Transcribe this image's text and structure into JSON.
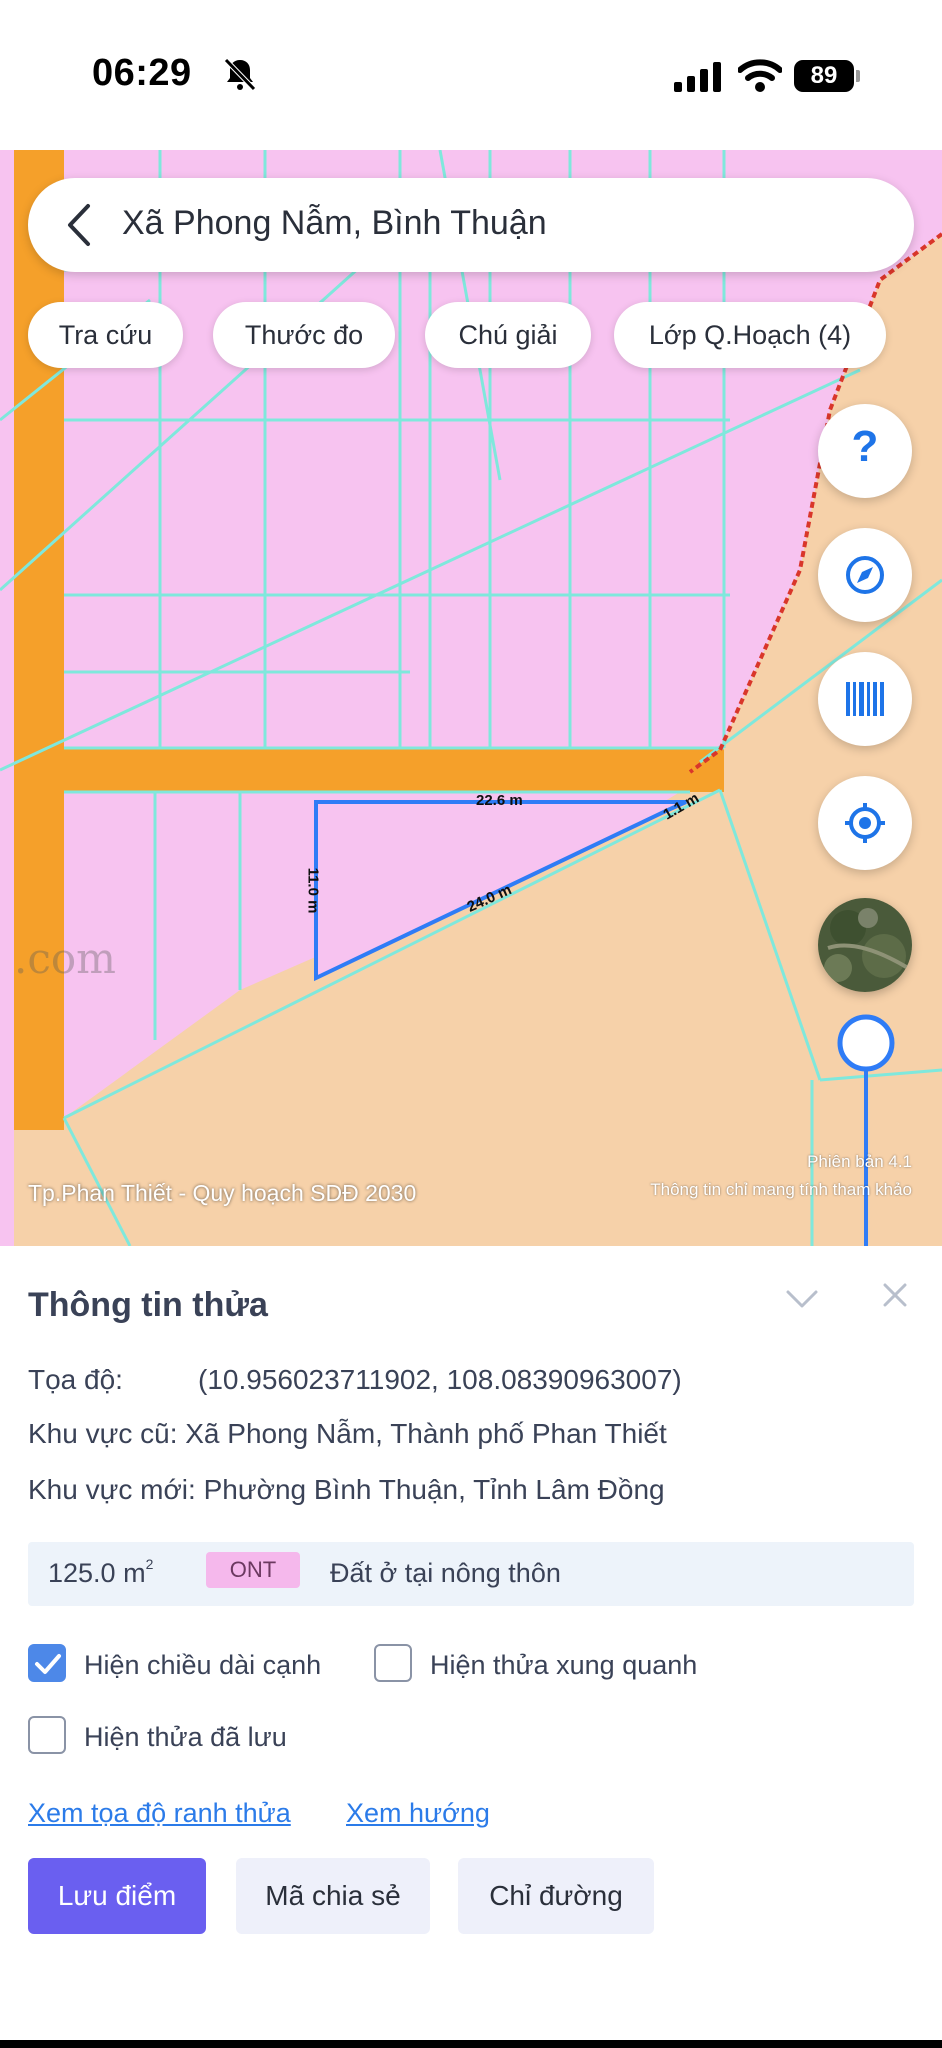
{
  "status_bar": {
    "time": "06:29",
    "battery": "89"
  },
  "search": {
    "title": "Xã Phong Nẫm, Bình Thuận"
  },
  "chips": [
    {
      "label": "Tra cứu"
    },
    {
      "label": "Thước đo"
    },
    {
      "label": "Chú giải"
    },
    {
      "label": "Lớp Q.Hoạch (4)"
    }
  ],
  "map": {
    "measurements": {
      "top": "22.6 m",
      "left": "11.0 m",
      "diagonal": "24.0 m",
      "corner": "1.1 m"
    },
    "watermark": ".com",
    "caption_left": "Tp.Phan Thiết - Quy hoạch SDĐ 2030",
    "caption_version": "Phiên bản 4.1",
    "caption_note": "Thông tin chỉ mang tính tham khảo",
    "colors": {
      "residential": "#f7c3f0",
      "agricultural": "#f6d1a9",
      "road": "#f5a02a",
      "parcel_lines": "#7fe8dc",
      "selection": "#2f7cf6"
    }
  },
  "panel": {
    "title": "Thông tin thửa",
    "coord_label": "Tọa độ:",
    "coord_value": "(10.956023711902, 108.08390963007)",
    "old_area": "Khu vực cũ: Xã Phong Nẫm, Thành phố Phan Thiết",
    "new_area": "Khu vực mới: Phường Bình Thuận, Tỉnh Lâm Đồng",
    "land": {
      "area": "125.0 m",
      "area_unit_sup": "2",
      "code": "ONT",
      "type": "Đất ở tại nông thôn"
    },
    "options": {
      "show_edge_length": {
        "label": "Hiện chiều dài cạnh",
        "checked": true
      },
      "show_neighbors": {
        "label": "Hiện thửa xung quanh",
        "checked": false
      },
      "show_saved": {
        "label": "Hiện thửa đã lưu",
        "checked": false
      }
    },
    "links": {
      "boundary_coords": "Xem tọa độ ranh thửa",
      "direction": "Xem hướng"
    },
    "buttons": {
      "save": "Lưu điểm",
      "share": "Mã chia sẻ",
      "directions": "Chỉ đường"
    }
  }
}
